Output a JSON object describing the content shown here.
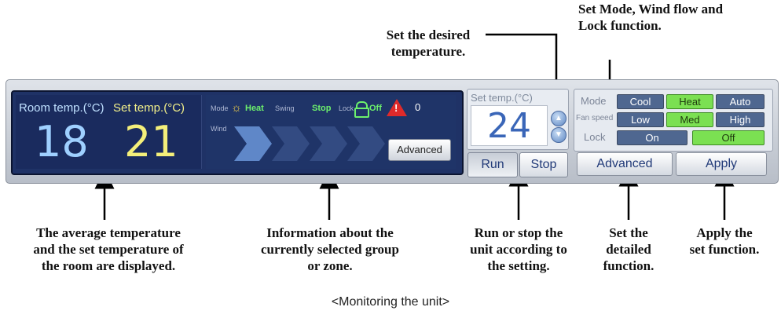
{
  "annotations": {
    "set_desired_temp": "Set the desired\ntemperature.",
    "set_mode": "Set Mode, Wind flow and\nLock function.",
    "average_temp": "The average temperature\nand the set temperature of\nthe room are displayed.",
    "information": "Information about the\ncurrently selected group\nor zone.",
    "run_stop": "Run or stop the\nunit according to\nthe setting.",
    "set_detailed": "Set the\ndetailed\nfunction.",
    "apply_function": "Apply the\nset function."
  },
  "display": {
    "room_label": "Room temp.(°C)",
    "set_label": "Set temp.(°C)",
    "room_value": "18",
    "set_value": "21"
  },
  "status": {
    "mode_label": "Mode",
    "mode_value": "Heat",
    "swing_label": "Swing",
    "swing_value": "Stop",
    "lock_label": "Lock",
    "lock_value": "Off",
    "alarm_count": "0",
    "wind_label": "Wind",
    "advanced_label": "Advanced"
  },
  "set_temp": {
    "label": "Set temp.(°C)",
    "value": "24"
  },
  "buttons": {
    "run": "Run",
    "stop": "Stop",
    "advanced": "Advanced",
    "apply": "Apply"
  },
  "control": {
    "mode_label": "Mode",
    "fan_label": "Fan speed",
    "lock_label": "Lock",
    "mode_options": [
      "Cool",
      "Heat",
      "Auto"
    ],
    "fan_options": [
      "Low",
      "Med",
      "High"
    ],
    "lock_options": [
      "On",
      "Off"
    ],
    "selected_mode": "Heat",
    "selected_fan": "Med",
    "selected_lock": "Off"
  },
  "caption": "<Monitoring the unit>",
  "colors": {
    "selected_green": "#7be052",
    "panel_dark": "#1f3266",
    "room_blue": "#9fd0ff",
    "set_yellow": "#f4ef7a",
    "alarm_red": "#e02a2a"
  }
}
